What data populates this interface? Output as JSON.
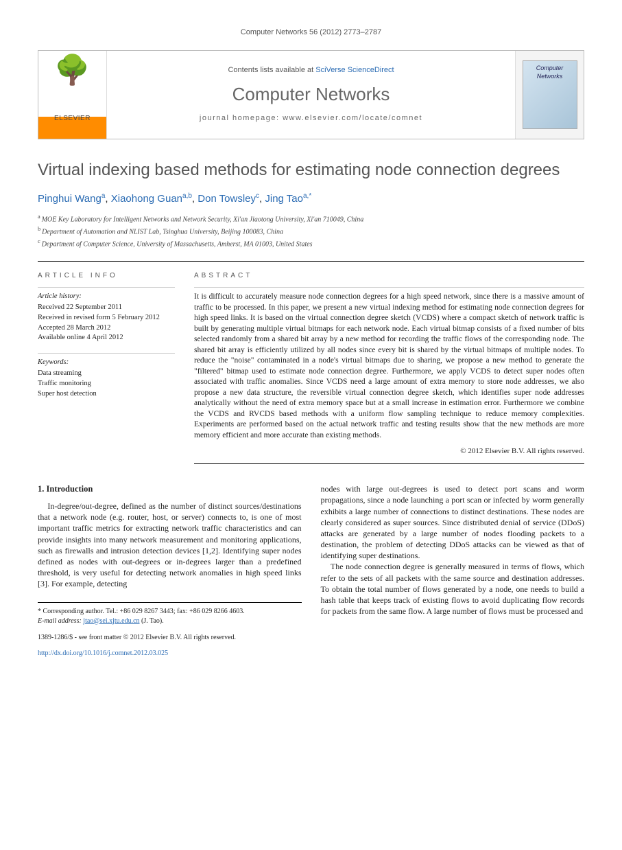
{
  "header": {
    "running_head": "Computer Networks 56 (2012) 2773–2787"
  },
  "masthead": {
    "publisher": "ELSEVIER",
    "contents_prefix": "Contents lists available at ",
    "contents_link": "SciVerse ScienceDirect",
    "journal_title": "Computer Networks",
    "homepage_label": "journal homepage: www.elsevier.com/locate/comnet",
    "cover_text": "Computer Networks"
  },
  "article": {
    "title": "Virtual indexing based methods for estimating node connection degrees",
    "authors": [
      {
        "name": "Pinghui Wang",
        "sup": "a"
      },
      {
        "name": "Xiaohong Guan",
        "sup": "a,b"
      },
      {
        "name": "Don Towsley",
        "sup": "c"
      },
      {
        "name": "Jing Tao",
        "sup": "a,*"
      }
    ],
    "affiliations": [
      {
        "sup": "a",
        "text": "MOE Key Laboratory for Intelligent Networks and Network Security, Xi'an Jiaotong University, Xi'an 710049, China"
      },
      {
        "sup": "b",
        "text": "Department of Automation and NLIST Lab, Tsinghua University, Beijing 100083, China"
      },
      {
        "sup": "c",
        "text": "Department of Computer Science, University of Massachusetts, Amherst, MA 01003, United States"
      }
    ]
  },
  "info": {
    "heading": "ARTICLE INFO",
    "history_label": "Article history:",
    "history": [
      "Received 22 September 2011",
      "Received in revised form 5 February 2012",
      "Accepted 28 March 2012",
      "Available online 4 April 2012"
    ],
    "keywords_label": "Keywords:",
    "keywords": [
      "Data streaming",
      "Traffic monitoring",
      "Super host detection"
    ]
  },
  "abstract": {
    "heading": "ABSTRACT",
    "text": "It is difficult to accurately measure node connection degrees for a high speed network, since there is a massive amount of traffic to be processed. In this paper, we present a new virtual indexing method for estimating node connection degrees for high speed links. It is based on the virtual connection degree sketch (VCDS) where a compact sketch of network traffic is built by generating multiple virtual bitmaps for each network node. Each virtual bitmap consists of a fixed number of bits selected randomly from a shared bit array by a new method for recording the traffic flows of the corresponding node. The shared bit array is efficiently utilized by all nodes since every bit is shared by the virtual bitmaps of multiple nodes. To reduce the \"noise\" contaminated in a node's virtual bitmaps due to sharing, we propose a new method to generate the \"filtered\" bitmap used to estimate node connection degree. Furthermore, we apply VCDS to detect super nodes often associated with traffic anomalies. Since VCDS need a large amount of extra memory to store node addresses, we also propose a new data structure, the reversible virtual connection degree sketch, which identifies super node addresses analytically without the need of extra memory space but at a small increase in estimation error. Furthermore we combine the VCDS and RVCDS based methods with a uniform flow sampling technique to reduce memory complexities. Experiments are performed based on the actual network traffic and testing results show that the new methods are more memory efficient and more accurate than existing methods.",
    "copyright": "© 2012 Elsevier B.V. All rights reserved."
  },
  "body": {
    "section_heading": "1. Introduction",
    "col1": "In-degree/out-degree, defined as the number of distinct sources/destinations that a network node (e.g. router, host, or server) connects to, is one of most important traffic metrics for extracting network traffic characteristics and can provide insights into many network measurement and monitoring applications, such as firewalls and intrusion detection devices [1,2]. Identifying super nodes defined as nodes with out-degrees or in-degrees larger than a predefined threshold, is very useful for detecting network anomalies in high speed links [3]. For example, detecting",
    "col2_p1": "nodes with large out-degrees is used to detect port scans and worm propagations, since a node launching a port scan or infected by worm generally exhibits a large number of connections to distinct destinations. These nodes are clearly considered as super sources. Since distributed denial of service (DDoS) attacks are generated by a large number of nodes flooding packets to a destination, the problem of detecting DDoS attacks can be viewed as that of identifying super destinations.",
    "col2_p2": "The node connection degree is generally measured in terms of flows, which refer to the sets of all packets with the same source and destination addresses. To obtain the total number of flows generated by a node, one needs to build a hash table that keeps track of existing flows to avoid duplicating flow records for packets from the same flow. A large number of flows must be processed and"
  },
  "footnotes": {
    "corr": "* Corresponding author. Tel.: +86 029 8267 3443; fax: +86 029 8266 4603.",
    "email_label": "E-mail address:",
    "email": "jtao@sei.xjtu.edu.cn",
    "email_name": "(J. Tao).",
    "front_matter": "1389-1286/$ - see front matter © 2012 Elsevier B.V. All rights reserved.",
    "doi": "http://dx.doi.org/10.1016/j.comnet.2012.03.025"
  }
}
